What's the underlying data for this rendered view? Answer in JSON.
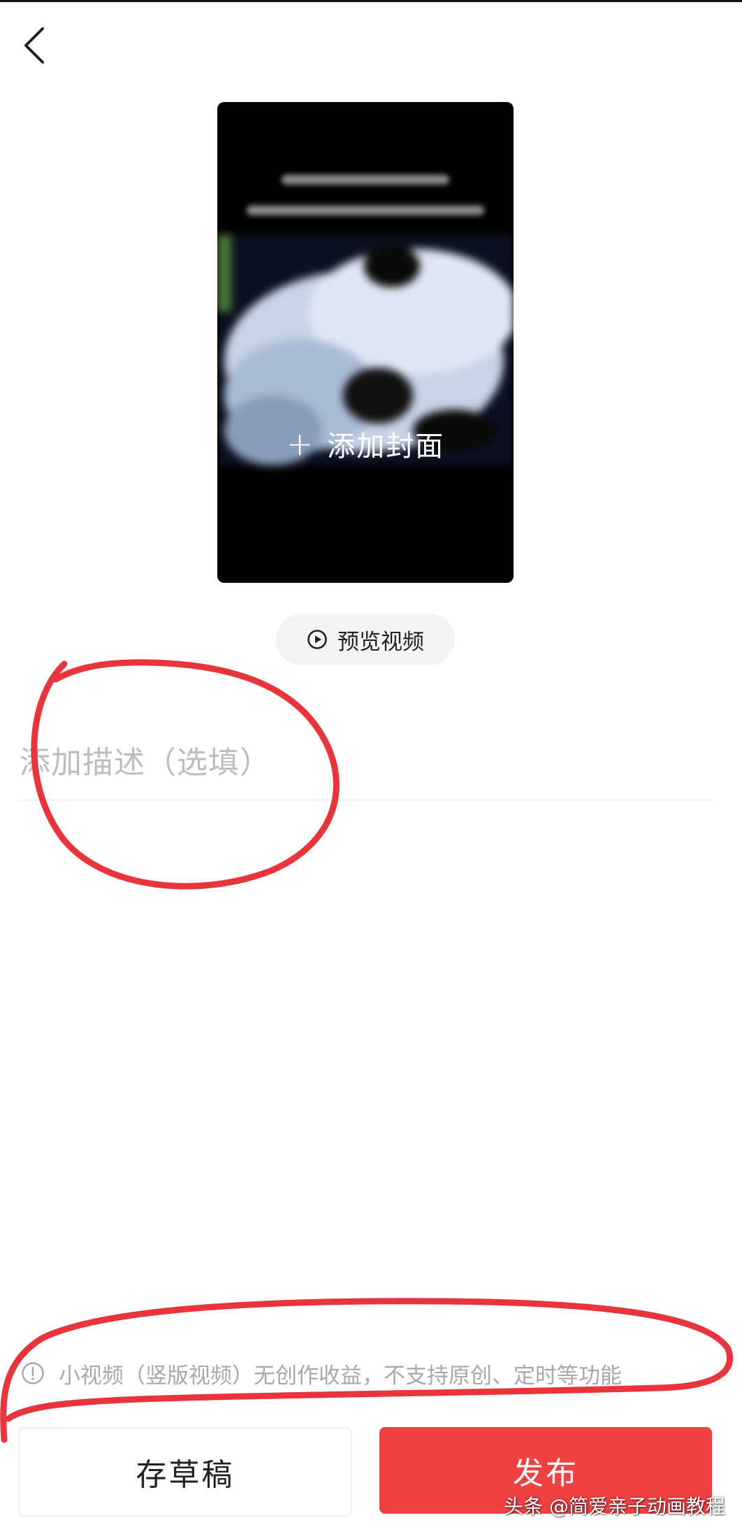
{
  "header": {
    "back_icon": "chevron-left-icon"
  },
  "cover": {
    "add_label": "添加封面",
    "plus_icon": "plus-icon"
  },
  "preview": {
    "label": "预览视频",
    "icon": "play-circle-icon"
  },
  "description": {
    "placeholder": "添加描述（选填）",
    "value": ""
  },
  "notice": {
    "icon": "info-circle-icon",
    "text": "小视频（竖版视频）无创作收益，不支持原创、定时等功能"
  },
  "actions": {
    "draft_label": "存草稿",
    "publish_label": "发布"
  },
  "watermark": {
    "text": "头条 @简爱亲子动画教程"
  },
  "colors": {
    "accent": "#f04142",
    "annotation": "#e8353c",
    "placeholder": "#bdbdbd",
    "muted_text": "#a8a8a8"
  }
}
